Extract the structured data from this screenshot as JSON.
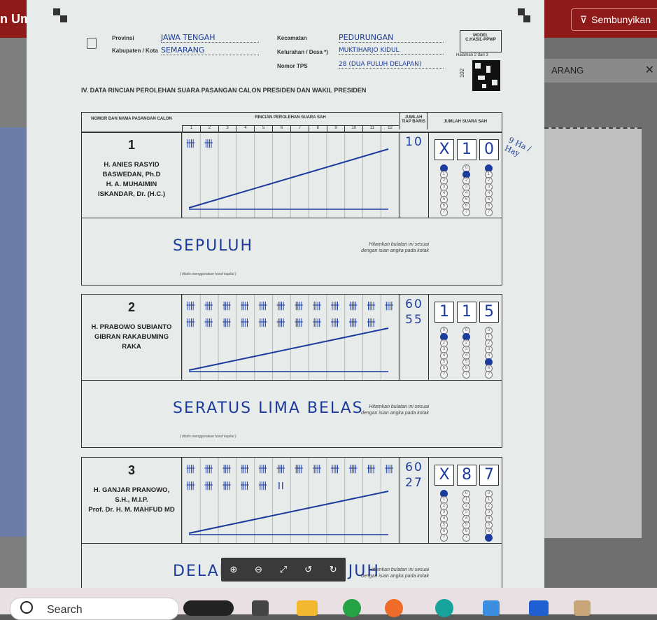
{
  "app": {
    "title": "n Um",
    "hide_button": "Sembunyikan",
    "right_panel_label": "ARANG"
  },
  "form": {
    "labels": {
      "provinsi": "Provinsi",
      "kabupaten": "Kabupaten / Kota",
      "kecamatan": "Kecamatan",
      "kelurahan": "Kelurahan / Desa *)",
      "tps": "Nomor TPS"
    },
    "values": {
      "provinsi": "JAWA TENGAH",
      "kabupaten": "SEMARANG",
      "kecamatan": "PEDURUNGAN",
      "kelurahan": "MUKTIHARJO KIDUL",
      "tps": "28 (DUA PULUH DELAPAN)"
    },
    "model": {
      "line1": "MODEL",
      "line2": "C.HASIL-PPWP",
      "page": "Halaman 2 dari 3"
    },
    "code": "102",
    "section_title": "IV.   DATA RINCIAN PEROLEHAN SUARA PASANGAN CALON PRESIDEN DAN WAKIL PRESIDEN",
    "headers": {
      "candidate": "NOMOR DAN NAMA PASANGAN CALON",
      "tally": "RINCIAN PEROLEHAN SUARA SAH",
      "row_sum": "JUMLAH TIAP BARIS",
      "total": "JUMLAH SUARA SAH"
    },
    "tally_columns": [
      "1",
      "2",
      "3",
      "4",
      "5",
      "6",
      "7",
      "8",
      "9",
      "10",
      "11",
      "12"
    ],
    "hint_text": "Hitamkan bulatan ini sesuai dengan isian angka pada kotak",
    "hint_caps": "( ditulis menggunakan huruf kapital )",
    "candidates": [
      {
        "number": "1",
        "name_lines": [
          "H. ANIES RASYID",
          "BASWEDAN, Ph.D",
          "H. A. MUHAIMIN",
          "ISKANDAR, Dr. (H.C.)"
        ],
        "tally_rows": [
          [
            "卌",
            "卌"
          ]
        ],
        "row_sums": [
          "10"
        ],
        "digits": [
          "X",
          "1",
          "0"
        ],
        "words": "SEPULUH",
        "filled": [
          0,
          1,
          0
        ]
      },
      {
        "number": "2",
        "name_lines": [
          "H. PRABOWO SUBIANTO",
          "GIBRAN RAKABUMING",
          "RAKA"
        ],
        "tally_rows": [
          [
            "卌",
            "卌",
            "卌",
            "卌",
            "卌",
            "卌",
            "卌",
            "卌",
            "卌",
            "卌",
            "卌",
            "卌"
          ],
          [
            "卌",
            "卌",
            "卌",
            "卌",
            "卌",
            "卌",
            "卌",
            "卌",
            "卌",
            "卌",
            "卌"
          ]
        ],
        "row_sums": [
          "60",
          "55"
        ],
        "digits": [
          "1",
          "1",
          "5"
        ],
        "words": "SERATUS LIMA BELAS",
        "filled": [
          1,
          1,
          5
        ]
      },
      {
        "number": "3",
        "name_lines": [
          "H. GANJAR PRANOWO,",
          "S.H., M.I.P.",
          "Prof. Dr. H. M. MAHFUD MD"
        ],
        "tally_rows": [
          [
            "卌",
            "卌",
            "卌",
            "卌",
            "卌",
            "卌",
            "卌",
            "卌",
            "卌",
            "卌",
            "卌",
            "卌"
          ],
          [
            "卌",
            "卌",
            "卌",
            "卌",
            "卌",
            "II"
          ]
        ],
        "row_sums": [
          "60",
          "27"
        ],
        "digits": [
          "X",
          "8",
          "7"
        ],
        "words": "DELAPAN PULUH TUJUH",
        "filled": [
          0,
          8,
          7
        ]
      }
    ],
    "margin_note": "9 Ha / Hay"
  },
  "viewer_toolbar": {
    "zoom_in": "⊕",
    "zoom_out": "⊖",
    "fit": "⤢",
    "rotate_left": "↺",
    "rotate_right": "↻"
  },
  "taskbar": {
    "search_placeholder": "Search"
  }
}
